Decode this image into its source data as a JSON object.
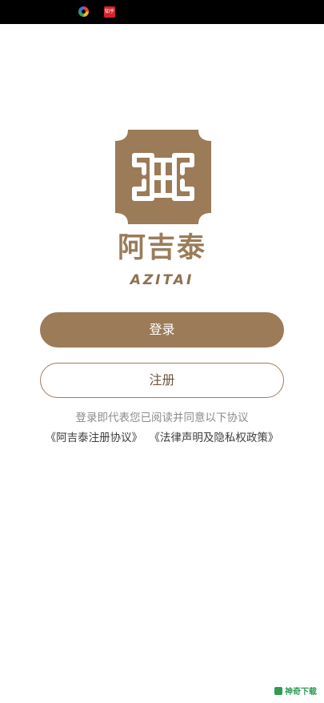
{
  "status_bar": {
    "badge_text": "知乎"
  },
  "brand": {
    "name_cn": "阿吉泰",
    "name_en": "AZITAI",
    "color": "#9b7b58"
  },
  "actions": {
    "login_label": "登录",
    "register_label": "注册"
  },
  "agreement": {
    "notice": "登录即代表您已阅读并同意以下协议",
    "links": [
      "《阿吉泰注册协议》",
      "《法律声明及隐私权政策》"
    ]
  },
  "watermark": {
    "text": "神奇下载"
  }
}
